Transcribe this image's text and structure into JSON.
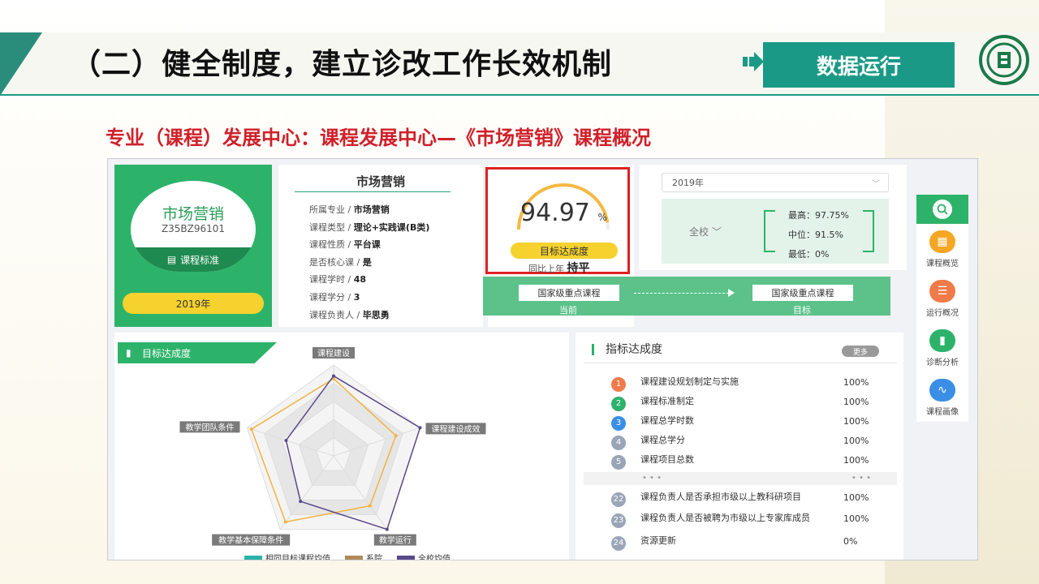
{
  "slide": {
    "title": "（二）健全制度，建立诊改工作长效机制",
    "tag": "数据运行",
    "subtitle": "专业（课程）发展中心：课程发展中心—《市场营销》课程概况"
  },
  "course_card": {
    "name": "市场营销",
    "code": "Z35BZ96101",
    "standard_label": "课程标准",
    "year": "2019年"
  },
  "info": {
    "title": "市场营销",
    "rows": [
      {
        "k": "所属专业 / ",
        "v": "市场营销"
      },
      {
        "k": "课程类型 / ",
        "v": "理论+实践课(B类)"
      },
      {
        "k": "课程性质 / ",
        "v": "平台课"
      },
      {
        "k": "是否核心课 / ",
        "v": "是"
      },
      {
        "k": "课程学时 / ",
        "v": "48"
      },
      {
        "k": "课程学分 / ",
        "v": "3"
      },
      {
        "k": "课程负责人 / ",
        "v": "毕思勇"
      }
    ]
  },
  "score": {
    "value": "94.97",
    "unit": "%",
    "label": "目标达成度",
    "compare_prefix": "同比上年",
    "compare_value": "持平",
    "fraction": 0.9497
  },
  "filter": {
    "year": "2019年",
    "scope": "全校",
    "max": "最高：97.75%",
    "median": "中位：91.5%",
    "min": "最低：0%"
  },
  "target": {
    "current_box": "国家级重点课程",
    "current_cap": "当前",
    "goal_box": "国家级重点课程",
    "goal_cap": "目标"
  },
  "nav": [
    {
      "label": "课程概览",
      "color": "#f5a623",
      "icon": "grid-icon",
      "glyph": "▦"
    },
    {
      "label": "运行概况",
      "color": "#f07a4a",
      "icon": "list-icon",
      "glyph": "☰"
    },
    {
      "label": "诊断分析",
      "color": "#2db369",
      "icon": "bar-chart-icon",
      "glyph": "▮"
    },
    {
      "label": "课程画像",
      "color": "#3a8ee6",
      "icon": "trend-icon",
      "glyph": "∿"
    }
  ],
  "radar": {
    "tab_label": "目标达成度",
    "axes": [
      "课程建设",
      "课程建设成效",
      "教学运行",
      "教学基本保障条件",
      "教学团队条件"
    ],
    "legend": [
      "相同目标课程均值",
      "系院",
      "全校均值"
    ]
  },
  "chart_data": {
    "type": "radar",
    "categories": [
      "课程建设",
      "课程建设成效",
      "教学运行",
      "教学基本保障条件",
      "教学团队条件"
    ],
    "series": [
      {
        "name": "系院",
        "color": "#f2b340",
        "values": [
          0.85,
          0.72,
          0.68,
          0.9,
          0.95
        ]
      },
      {
        "name": "全校均值",
        "color": "#5a4a8a",
        "values": [
          0.88,
          1.0,
          1.0,
          0.62,
          0.55
        ]
      }
    ],
    "rmax": 1.0
  },
  "indicators": {
    "title": "指标达成度",
    "more": "更多",
    "rows": [
      {
        "num": "1",
        "color": "#f07a4a",
        "text": "课程建设规划制定与实施",
        "val": "100%"
      },
      {
        "num": "2",
        "color": "#2db369",
        "text": "课程标准制定",
        "val": "100%"
      },
      {
        "num": "3",
        "color": "#3a8ee6",
        "text": "课程总学时数",
        "val": "100%"
      },
      {
        "num": "4",
        "color": "#9aa5b8",
        "text": "课程总学分",
        "val": "100%"
      },
      {
        "num": "5",
        "color": "#9aa5b8",
        "text": "课程项目总数",
        "val": "100%"
      },
      {
        "num": "22",
        "color": "#9aa5b8",
        "text": "课程负责人是否承担市级以上教科研项目",
        "val": "100%"
      },
      {
        "num": "23",
        "color": "#9aa5b8",
        "text": "课程负责人是否被聘为市级以上专家库成员",
        "val": "100%"
      },
      {
        "num": "24",
        "color": "#9aa5b8",
        "text": "资源更新",
        "val": "0%"
      }
    ],
    "ellipsis": "• • •"
  }
}
